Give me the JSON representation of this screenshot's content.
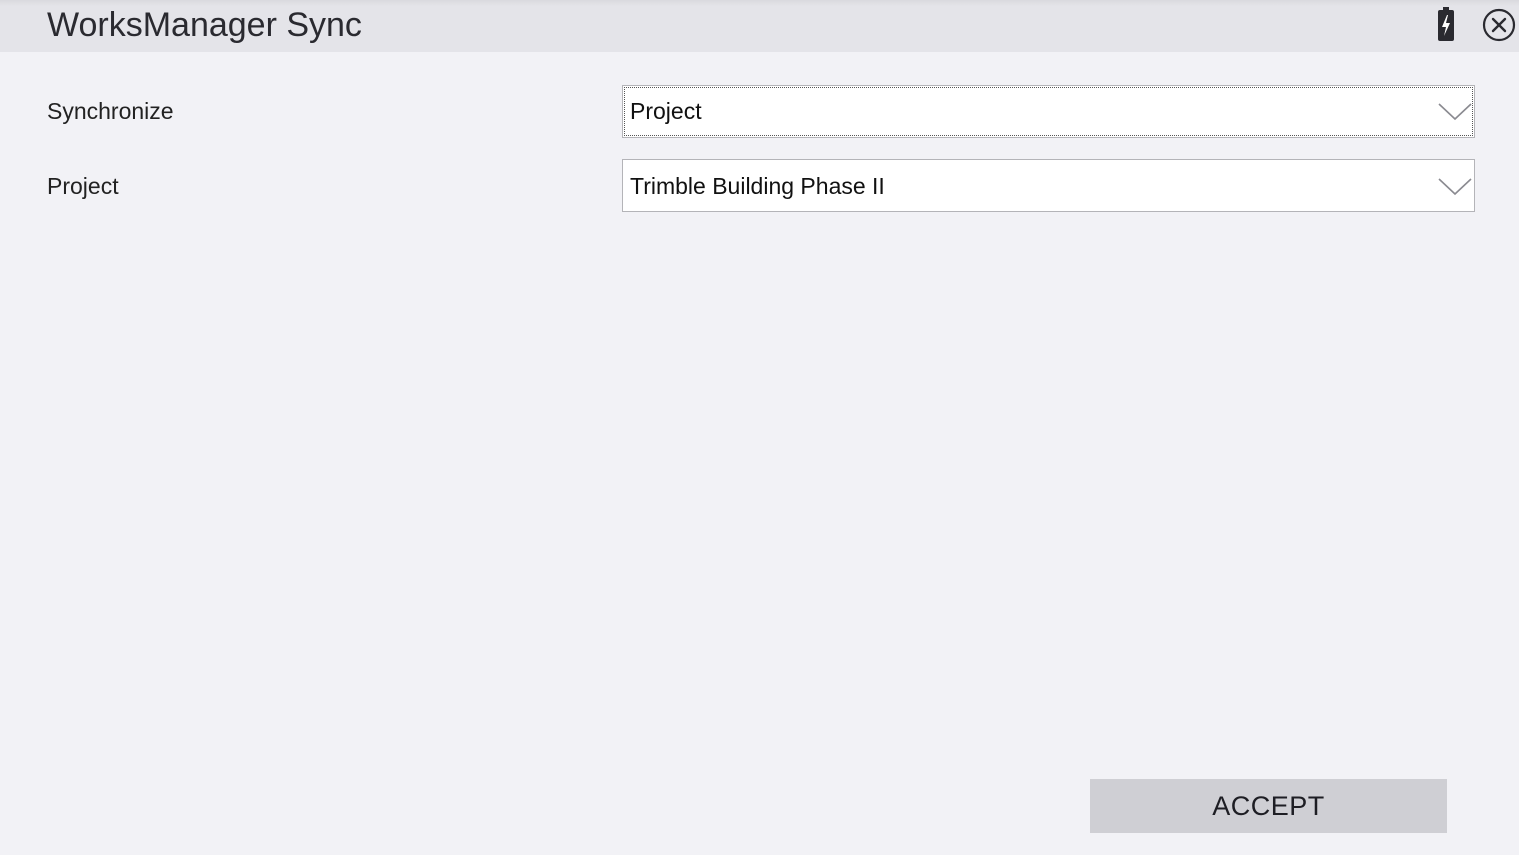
{
  "window": {
    "title": "WorksManager Sync",
    "icons": {
      "battery": "battery-charging-icon",
      "close": "close-circle-icon"
    }
  },
  "form": {
    "synchronize": {
      "label": "Synchronize",
      "value": "Project"
    },
    "project": {
      "label": "Project",
      "value": "Trimble Building Phase II"
    }
  },
  "actions": {
    "accept_label": "ACCEPT"
  },
  "colors": {
    "background": "#f2f2f6",
    "titlebar": "#e4e4e9",
    "button": "#cfcfd4",
    "field": "#ffffff"
  }
}
